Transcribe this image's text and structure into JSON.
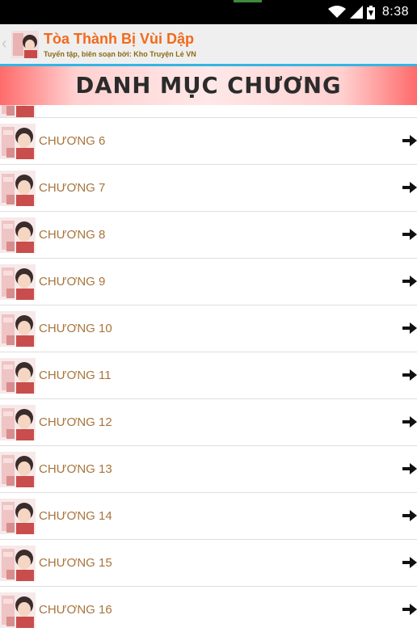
{
  "status_bar": {
    "time": "8:38"
  },
  "app": {
    "title": "Tòa Thành Bị Vùi Dập",
    "subtitle": "Tuyển tập, biên soạn bởi: Kho Truyện Lẻ VN"
  },
  "banner": {
    "title": "DANH MỤC CHƯƠNG"
  },
  "chapters": [
    "CHƯƠNG 6",
    "CHƯƠNG 7",
    "CHƯƠNG 8",
    "CHƯƠNG 9",
    "CHƯƠNG 10",
    "CHƯƠNG 11",
    "CHƯƠNG 12",
    "CHƯƠNG 13",
    "CHƯƠNG 14",
    "CHƯƠNG 15",
    "CHƯƠNG 16"
  ],
  "icons": {
    "wifi": "wifi-icon",
    "signal": "signal-icon",
    "battery": "battery-icon",
    "back": "chevron-left-icon",
    "row_arrow": "arrow-right-icon"
  },
  "colors": {
    "title": "#f26a1b",
    "subtitle": "#8a6a14",
    "chapter_text": "#a8743c",
    "action_bar_border": "#33b5e5",
    "banner_edge": "#ff6b6b"
  }
}
